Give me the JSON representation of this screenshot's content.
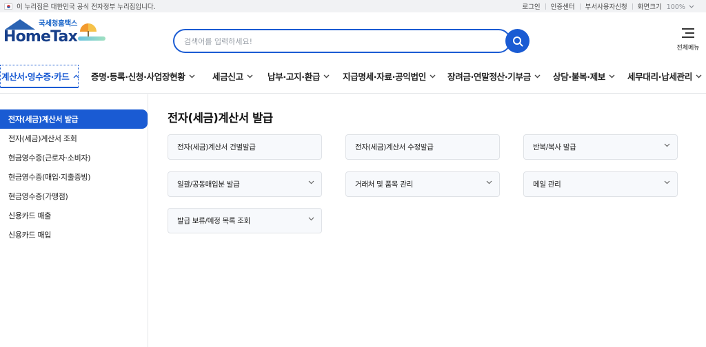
{
  "topbar": {
    "notice": "이 누리집은 대한민국 공식 전자정부 누리집입니다.",
    "links": [
      "로그인",
      "인증센터",
      "부서사용자신청"
    ],
    "zoom_label": "화면크기",
    "zoom_value": "100%"
  },
  "header": {
    "logo_kr": "국세청홈택스",
    "logo_en": "HomeTax",
    "search_placeholder": "검색어를 입력하세요!",
    "search_value": "",
    "allmenu_label": "전체메뉴"
  },
  "gnb": {
    "items": [
      "계산서·영수증·카드",
      "증명·등록·신청·사업장현황",
      "세금신고",
      "납부·고지·환급",
      "지급명세·자료·공익법인",
      "장려금·연말정산·기부금",
      "상담·불복·제보",
      "세무대리·납세관리"
    ],
    "active_index": 0
  },
  "lnb": {
    "items": [
      "전자(세금)계산서 발급",
      "전자(세금)계산서 조회",
      "현금영수증(근로자·소비자)",
      "현금영수증(매입·지출증빙)",
      "현금영수증(가맹점)",
      "신용카드 매출",
      "신용카드 매입"
    ],
    "active_index": 0
  },
  "content": {
    "title": "전자(세금)계산서 발급",
    "cards": [
      {
        "label": "전자(세금)계산서 건별발급",
        "dropdown": false
      },
      {
        "label": "전자(세금)계산서 수정발급",
        "dropdown": false
      },
      {
        "label": "반복/복사 발급",
        "dropdown": true
      },
      {
        "label": "일괄/공동매입분 발급",
        "dropdown": true
      },
      {
        "label": "거래처 및 품목 관리",
        "dropdown": true
      },
      {
        "label": "메일 관리",
        "dropdown": true
      },
      {
        "label": "발급 보류/예정 목록 조회",
        "dropdown": true
      }
    ]
  },
  "colors": {
    "accent": "#1a5bd3",
    "topbar_bg": "#f1f2f4",
    "card_bg": "#f7f9fc"
  }
}
